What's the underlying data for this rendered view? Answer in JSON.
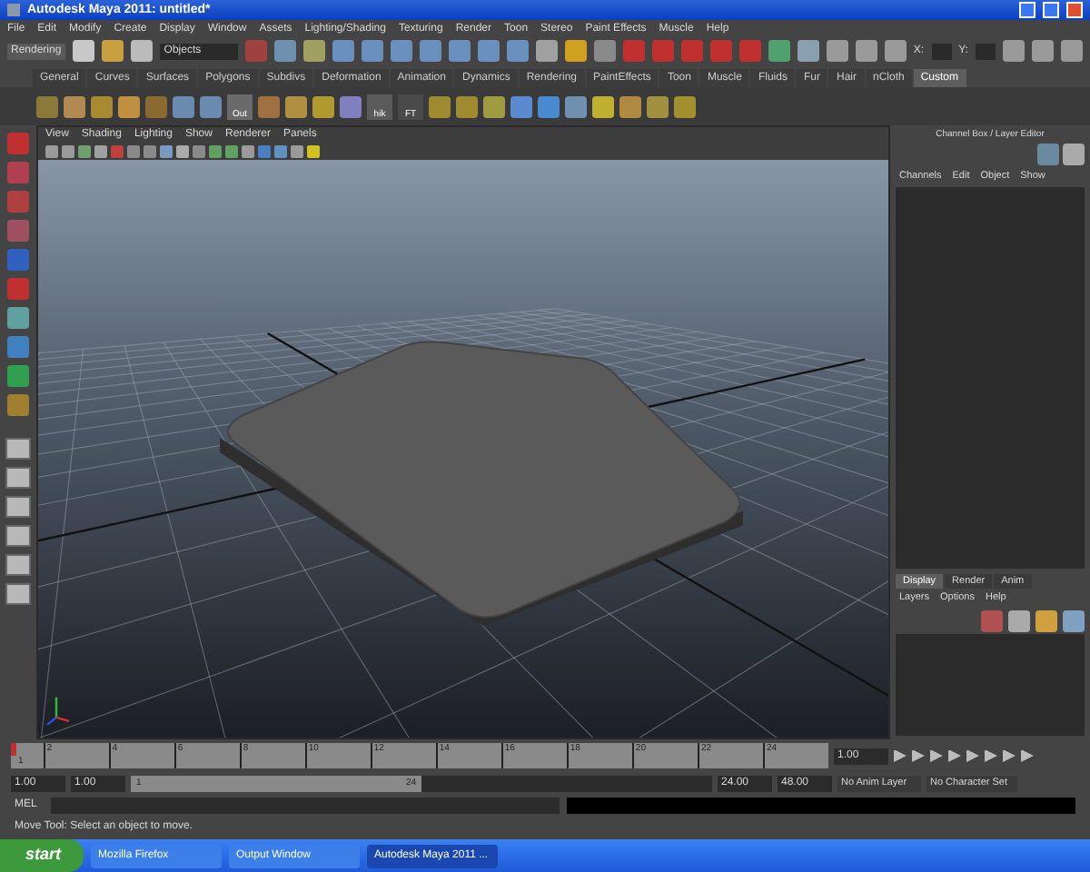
{
  "window": {
    "title": "Autodesk Maya 2011: untitled*"
  },
  "menu": [
    "File",
    "Edit",
    "Modify",
    "Create",
    "Display",
    "Window",
    "Assets",
    "Lighting/Shading",
    "Texturing",
    "Render",
    "Toon",
    "Stereo",
    "Paint Effects",
    "Muscle",
    "Help"
  ],
  "status_line": {
    "menu_set": "Rendering",
    "selection_field": "Objects",
    "x_label": "X:",
    "y_label": "Y:"
  },
  "shelf": {
    "tabs": [
      {
        "label": "General",
        "selected": false
      },
      {
        "label": "Curves",
        "selected": false
      },
      {
        "label": "Surfaces",
        "selected": false
      },
      {
        "label": "Polygons",
        "selected": false
      },
      {
        "label": "Subdivs",
        "selected": false
      },
      {
        "label": "Deformation",
        "selected": false
      },
      {
        "label": "Animation",
        "selected": false
      },
      {
        "label": "Dynamics",
        "selected": false
      },
      {
        "label": "Rendering",
        "selected": false
      },
      {
        "label": "PaintEffects",
        "selected": false
      },
      {
        "label": "Toon",
        "selected": false
      },
      {
        "label": "Muscle",
        "selected": false
      },
      {
        "label": "Fluids",
        "selected": false
      },
      {
        "label": "Fur",
        "selected": false
      },
      {
        "label": "Hair",
        "selected": false
      },
      {
        "label": "nCloth",
        "selected": false
      },
      {
        "label": "Custom",
        "selected": true
      }
    ],
    "icon_captions": [
      "Out",
      "hik",
      "FT"
    ]
  },
  "viewport": {
    "menu": [
      "View",
      "Shading",
      "Lighting",
      "Show",
      "Renderer",
      "Panels"
    ]
  },
  "channel_box": {
    "title": "Channel Box / Layer Editor",
    "menu": [
      "Channels",
      "Edit",
      "Object",
      "Show"
    ]
  },
  "layer_editor": {
    "tabs": [
      {
        "label": "Display",
        "selected": true
      },
      {
        "label": "Render",
        "selected": false
      },
      {
        "label": "Anim",
        "selected": false
      }
    ],
    "menu": [
      "Layers",
      "Options",
      "Help"
    ]
  },
  "timeline": {
    "start_label": "1",
    "ticks": [
      "2",
      "4",
      "6",
      "8",
      "10",
      "12",
      "14",
      "16",
      "18",
      "20",
      "22",
      "24"
    ],
    "current_time": "1.00",
    "level": 0
  },
  "range": {
    "start": "1.00",
    "playback_start": "1.00",
    "slider_start": "1",
    "slider_end": "24",
    "playback_end": "24.00",
    "end": "48.00",
    "anim_layer": "No Anim Layer",
    "character_set": "No Character Set",
    "level": 0.5
  },
  "command_line": {
    "label": "MEL"
  },
  "help_line": "Move Tool: Select an object to move.",
  "taskbar": {
    "start": "start",
    "buttons": [
      {
        "label": "Mozilla Firefox",
        "selected": false
      },
      {
        "label": "Output Window",
        "selected": false
      },
      {
        "label": "Autodesk Maya 2011 ...",
        "selected": true
      }
    ]
  }
}
